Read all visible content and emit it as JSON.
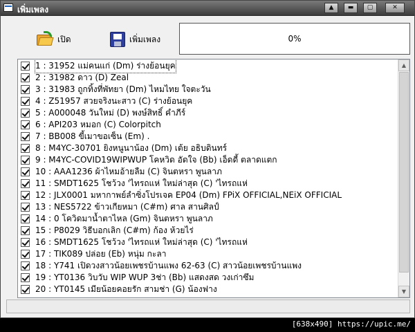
{
  "window": {
    "title": "เพิ่มเพลง",
    "controls": {
      "up": "▲",
      "minimize": "▬",
      "maximize": "▢",
      "close": "✕"
    }
  },
  "toolbar": {
    "open_label": "เปิด",
    "add_label": "เพิ่มเพลง",
    "open_icon": "open-folder-icon",
    "add_icon": "floppy-disk-icon",
    "progress_text": "0%",
    "progress_value": 0
  },
  "songs": [
    {
      "text": "1 : 31952 แม่คนแก่  (Dm) ร่างย้อนยุค",
      "checked": true
    },
    {
      "text": "2 : 31982 ดาว  (D) Zeal",
      "checked": true
    },
    {
      "text": "3 : 31983 ถูกทิ้งที่พัทยา  (Dm) ไหมไทย ใจตะวัน",
      "checked": true
    },
    {
      "text": "4 : Z51957 สวยจริงนะสาว (C) ร่างย้อนยุค",
      "checked": true
    },
    {
      "text": "5 : A000048 วันใหม่  (D) พงษ์สิทธิ์  คำภีร์",
      "checked": true
    },
    {
      "text": "6 : API203 หมอก (C) Colorpitch",
      "checked": true
    },
    {
      "text": "7 : BB008 ขี้เมาขอเซ็น (Em) .",
      "checked": true
    },
    {
      "text": "8 : M4YC-30701 ยิงหนูนาน้อง (Dm) เต้ย อธิบดินทร์",
      "checked": true
    },
    {
      "text": "9 : M4YC-COVID19WIPWUP โคหวิด อัดใจ  (Bb) เอ็ดดี้ ตลาดแตก",
      "checked": true
    },
    {
      "text": "10 : AAA1236 ผ้าไหมอ้ายลืม (C) จินตหรา พูนลาภ",
      "checked": true
    },
    {
      "text": "11 : SMDT1625 โชว้วง 'ไทรถแห่ ใหม่ล่าสุด (C) 'ไทรถแห่",
      "checked": true
    },
    {
      "text": "12 : JLX0001 มหากาพย์ลำซิ่งโปรเจค EP04 (Dm) FPiX OFFICIAL,NEiX OFFICIAL",
      "checked": true
    },
    {
      "text": "13 : NES5722 ข้าวเกียหมา (C#m) ศาล สานศิลป์",
      "checked": true
    },
    {
      "text": "14 : 0 โควิดมาน้ำตาไหล (Gm) จินตหรา พูนลาภ",
      "checked": true
    },
    {
      "text": "15 : P8029 วิธีบอกเลิก (C#m) ก้อง ห้วยไร่",
      "checked": true
    },
    {
      "text": "16 : SMDT1625 โชว้วง 'ไทรถแห่ ใหม่ล่าสุด (C) 'ไทรถแห่",
      "checked": true
    },
    {
      "text": "17 : TIK089 ปล่อย (Eb) หนุ่ม กะลา",
      "checked": true
    },
    {
      "text": "18 : Y741 เปิดวงสาวน้อยเพชรบ้านแพง 62-63 (C) สาวน้อยเพชรบ้านแพง",
      "checked": true
    },
    {
      "text": "19 : YT0136 วิบวับ WIP WUP 3ช่า (Bb) แสดงสด วงเก่าซึม",
      "checked": true
    },
    {
      "text": "20 : YT0145 เมียน้อยคอยรัก สามช่า (G) น้องฟาง",
      "checked": true
    }
  ],
  "scrollbar": {
    "up": "▲",
    "down": "▼"
  },
  "watermark": "[638x490] https://upic.me/"
}
